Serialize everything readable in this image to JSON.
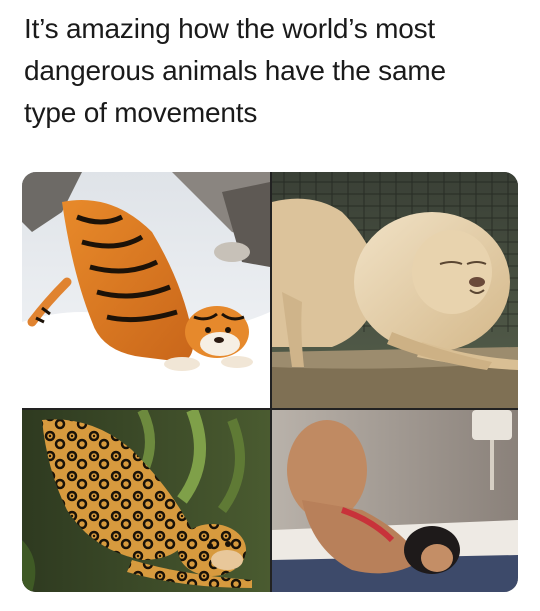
{
  "caption": {
    "line1": "It’s amazing how the world’s most",
    "line2": "dangerous animals have the same",
    "line3": "type of movements"
  },
  "panels": [
    {
      "subject": "tiger-stretching-in-snow"
    },
    {
      "subject": "lion-stretching-by-fence"
    },
    {
      "subject": "jaguar-stretching-in-jungle"
    },
    {
      "subject": "woman-stretching-on-bed"
    }
  ]
}
